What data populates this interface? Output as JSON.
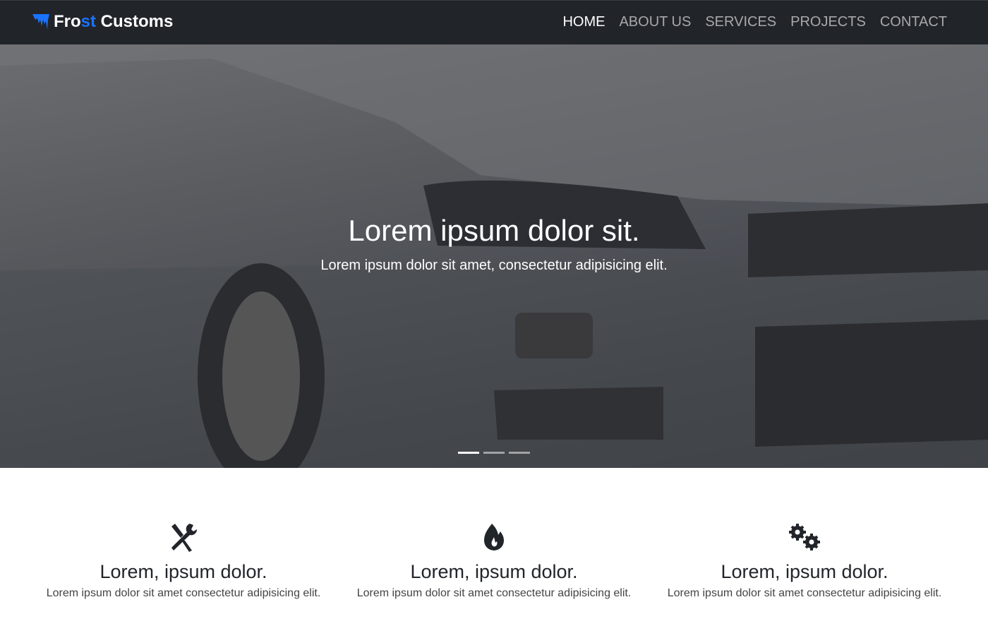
{
  "brand": {
    "part1": "Fro",
    "part2": "st",
    "part3": " Customs",
    "accent": "#1a73ff"
  },
  "nav": {
    "items": [
      {
        "label": "HOME"
      },
      {
        "label": "ABOUT US"
      },
      {
        "label": "SERVICES"
      },
      {
        "label": "PROJECTS"
      },
      {
        "label": "CONTACT"
      }
    ]
  },
  "hero": {
    "title": "Lorem ipsum dolor sit.",
    "subtitle": "Lorem ipsum dolor sit amet, consectetur adipisicing elit.",
    "slides": 3,
    "active_slide": 1
  },
  "features": [
    {
      "icon": "tools-icon",
      "title": "Lorem, ipsum dolor.",
      "text": "Lorem ipsum dolor sit amet consectetur adipisicing elit."
    },
    {
      "icon": "fire-icon",
      "title": "Lorem, ipsum dolor.",
      "text": "Lorem ipsum dolor sit amet consectetur adipisicing elit."
    },
    {
      "icon": "cogs-icon",
      "title": "Lorem, ipsum dolor.",
      "text": "Lorem ipsum dolor sit amet consectetur adipisicing elit."
    }
  ]
}
